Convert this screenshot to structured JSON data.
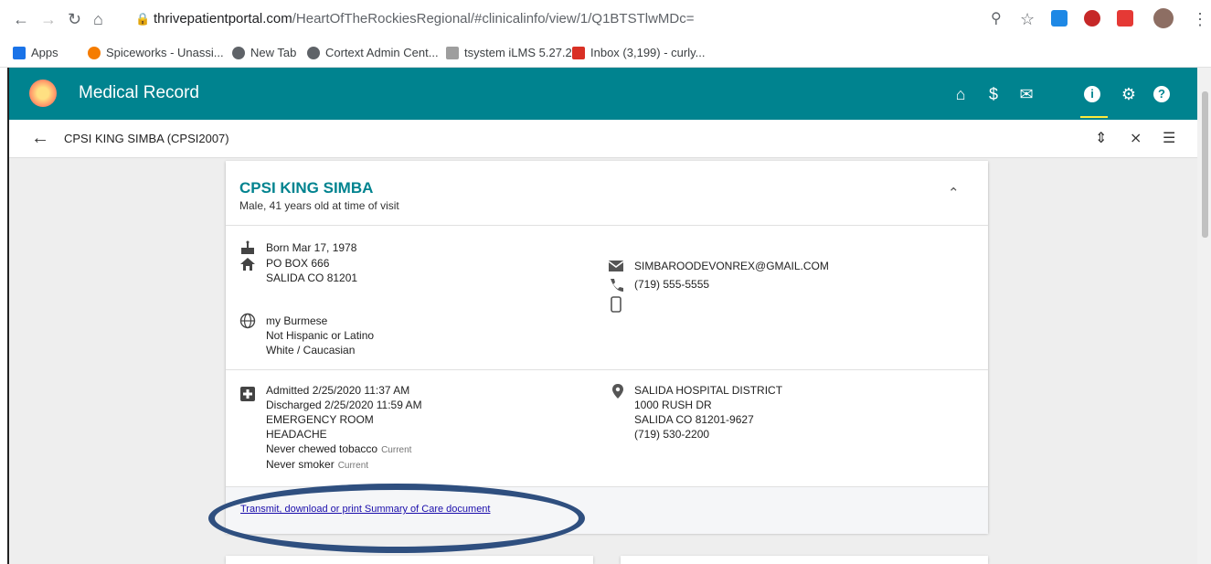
{
  "browser": {
    "url_host": "thrivepatientportal.com",
    "url_path": "/HeartOfTheRockiesRegional/#clinicalinfo/view/1/Q1BTSTlwMDc=",
    "bookmarks": [
      {
        "label": "Apps",
        "color": "#1a73e8"
      },
      {
        "label": "Spiceworks - Unassi...",
        "color": "#f57c00"
      },
      {
        "label": "New Tab",
        "color": "#5f6368"
      },
      {
        "label": "Cortext Admin Cent...",
        "color": "#5f6368"
      },
      {
        "label": "tsystem iLMS 5.27.2",
        "color": "#9e9e9e"
      },
      {
        "label": "Inbox (3,199) - curly...",
        "color": "#d93025"
      }
    ]
  },
  "app": {
    "title": "Medical Record",
    "header_color": "#00838f",
    "header_icons": [
      "home-icon",
      "dollar-icon",
      "mail-icon",
      "info-icon",
      "gear-icon",
      "help-icon"
    ]
  },
  "subheader": {
    "patient_label": "CPSI KING SIMBA (CPSI2007)"
  },
  "patient": {
    "name": "CPSI KING SIMBA",
    "description": "Male, 41 years old at time of visit",
    "born": "Born Mar 17, 1978",
    "address_line1": "PO BOX 666",
    "address_line2": "SALIDA CO 81201",
    "email": "SIMBAROODEVONREX@GMAIL.COM",
    "phone": "(719) 555-5555",
    "language": "my Burmese",
    "ethnicity": "Not Hispanic or Latino",
    "race": "White / Caucasian"
  },
  "visit": {
    "admitted": "Admitted 2/25/2020 11:37 AM",
    "discharged": "Discharged 2/25/2020 11:59 AM",
    "department": "EMERGENCY ROOM",
    "reason": "HEADACHE",
    "tobacco": "Never chewed tobacco",
    "tobacco_tag": "Current",
    "smoker": "Never smoker",
    "smoker_tag": "Current",
    "facility_name": "SALIDA HOSPITAL DISTRICT",
    "facility_address1": "1000 RUSH DR",
    "facility_address2": "SALIDA CO 81201-9627",
    "facility_phone": "(719) 530-2200"
  },
  "summary_link": "Transmit, download or print Summary of Care document"
}
